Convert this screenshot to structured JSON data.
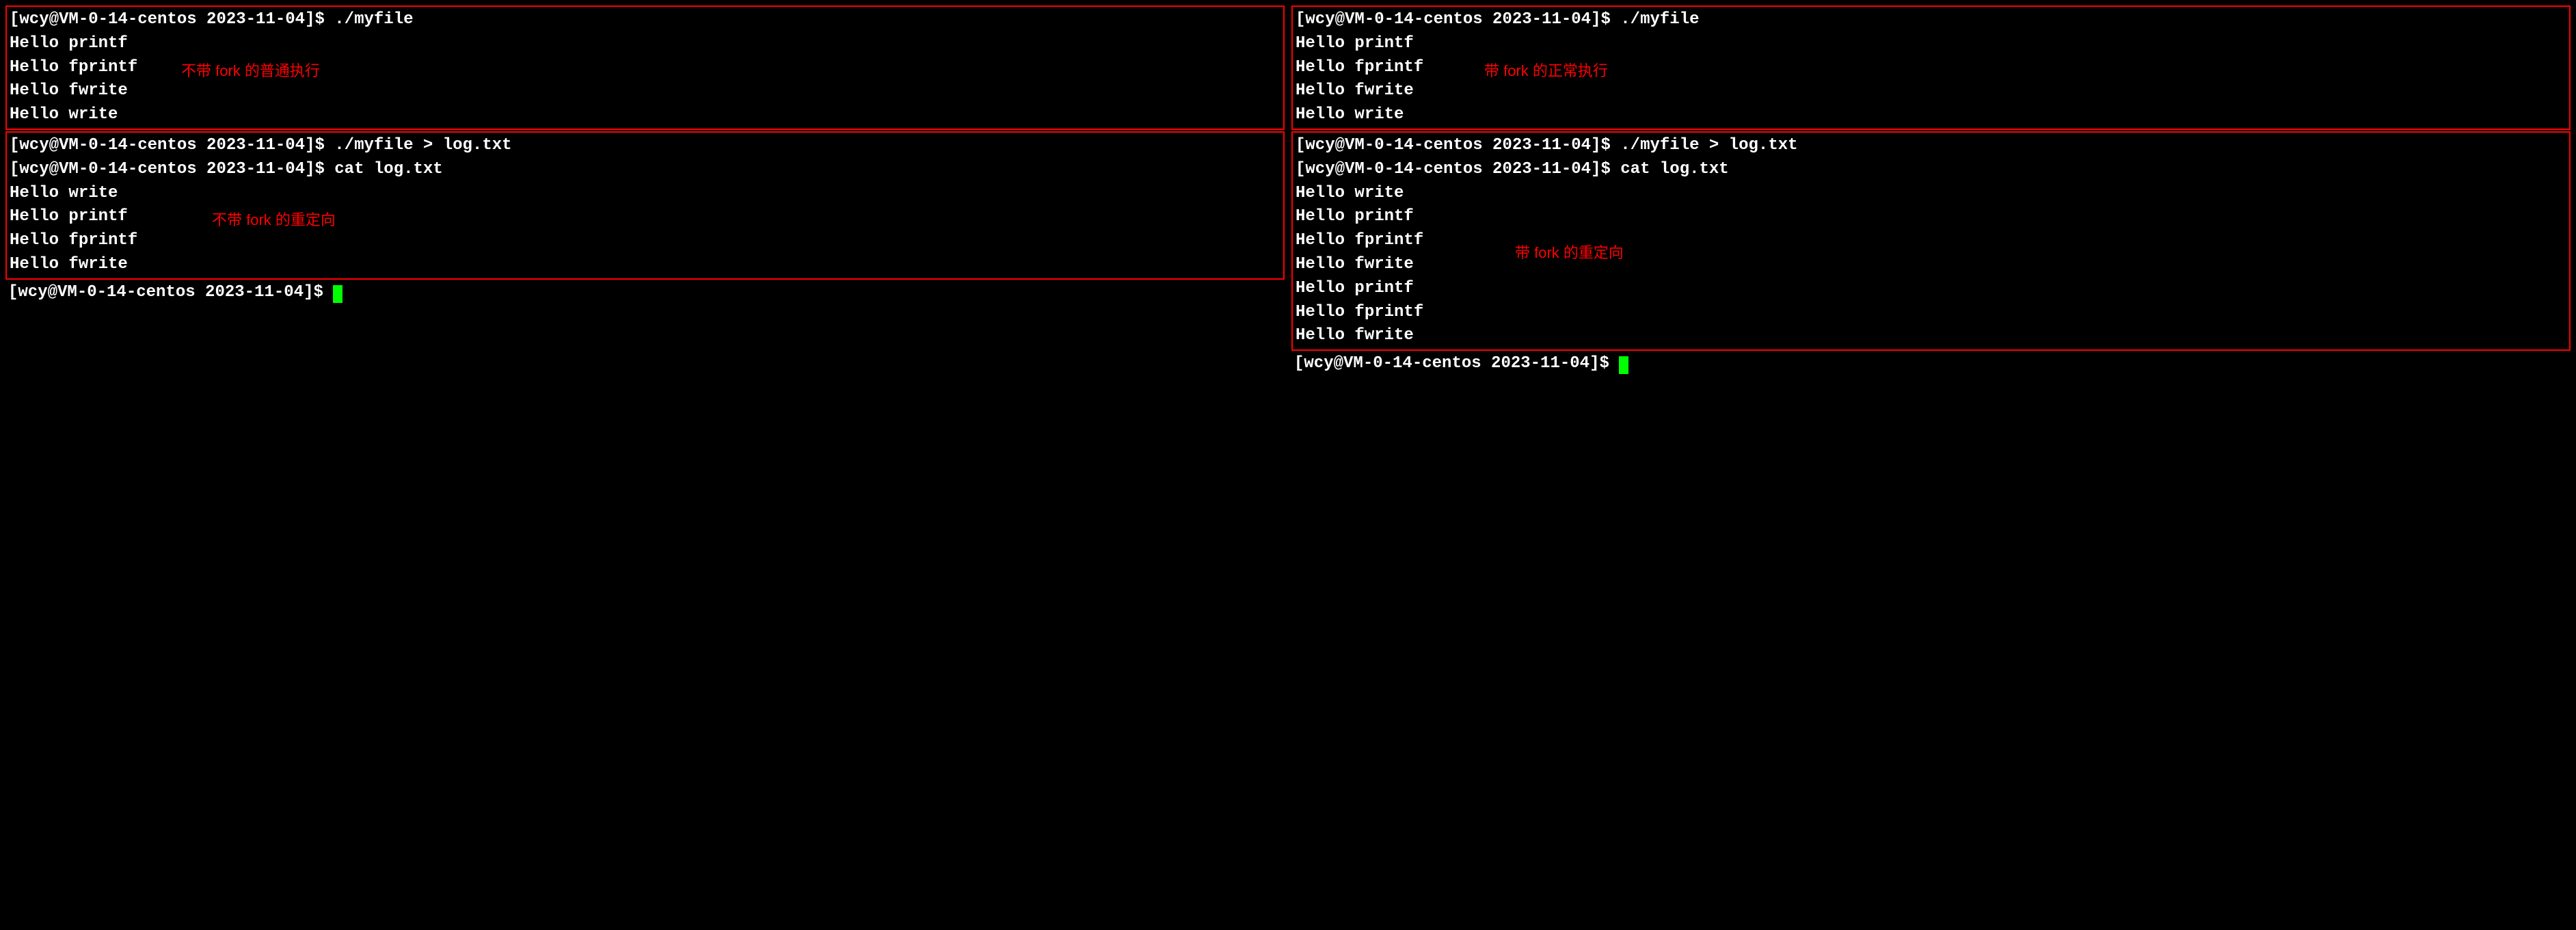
{
  "left": {
    "box1": {
      "lines": [
        "[wcy@VM-0-14-centos 2023-11-04]$ ./myfile",
        "Hello printf",
        "Hello fprintf",
        "Hello fwrite",
        "Hello write"
      ],
      "annotation": "不带 fork 的普通执行"
    },
    "box2": {
      "lines": [
        "[wcy@VM-0-14-centos 2023-11-04]$ ./myfile > log.txt",
        "[wcy@VM-0-14-centos 2023-11-04]$ cat log.txt",
        "Hello write",
        "Hello printf",
        "Hello fprintf",
        "Hello fwrite"
      ],
      "annotation": "不带 fork 的重定向"
    },
    "prompt": "[wcy@VM-0-14-centos 2023-11-04]$ "
  },
  "right": {
    "box1": {
      "lines": [
        "[wcy@VM-0-14-centos 2023-11-04]$ ./myfile",
        "Hello printf",
        "Hello fprintf",
        "Hello fwrite",
        "Hello write"
      ],
      "annotation": "带 fork 的正常执行"
    },
    "box2": {
      "lines": [
        "[wcy@VM-0-14-centos 2023-11-04]$ ./myfile > log.txt",
        "[wcy@VM-0-14-centos 2023-11-04]$ cat log.txt",
        "Hello write",
        "Hello printf",
        "Hello fprintf",
        "Hello fwrite",
        "Hello printf",
        "Hello fprintf",
        "Hello fwrite"
      ],
      "annotation": "带 fork 的重定向"
    },
    "prompt": "[wcy@VM-0-14-centos 2023-11-04]$ "
  }
}
